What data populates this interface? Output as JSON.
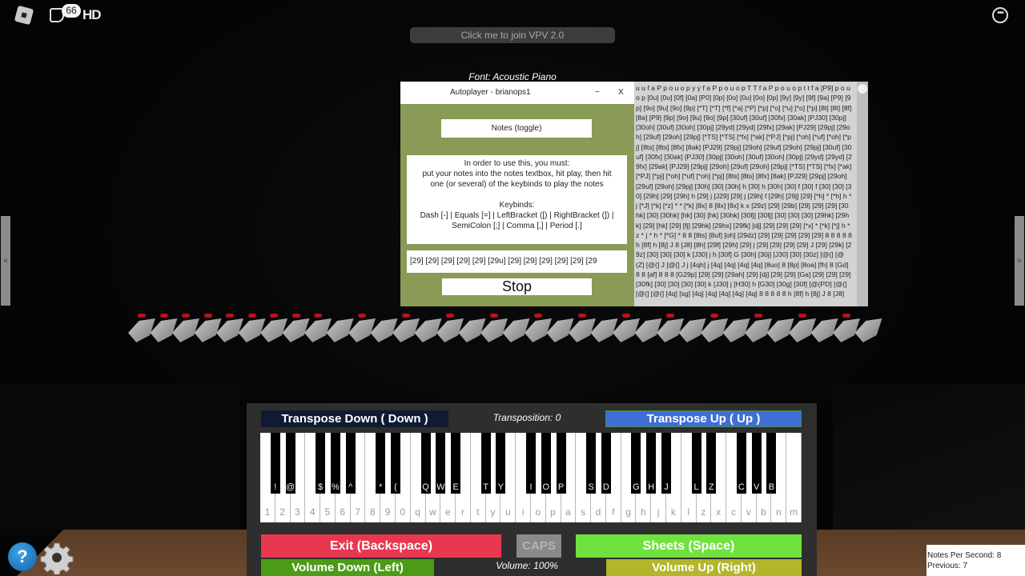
{
  "topbar": {
    "chat_badge_count": "66",
    "hd_label": "HD",
    "icons": [
      "roblox-logo-icon",
      "chat-icon",
      "menu-more-icon"
    ]
  },
  "join_button": {
    "label": "Click me to join VPV 2.0"
  },
  "font_label": "Font: Acoustic Piano",
  "side_arrows": {
    "left": "<",
    "right": ">"
  },
  "autoplayer": {
    "title": "Autoplayer - brianops1",
    "minimize_label": "~",
    "close_label": "X",
    "notes_toggle_label": "Notes (toggle)",
    "info": {
      "line1": "In order to use this, you must:",
      "line2": "put your notes into the notes textbox, hit play, then hit",
      "line3": "one (or several) of the keybinds to play the notes",
      "keybinds_title": "Keybinds:",
      "keybinds_line1": "Dash [-] | Equals [=] | LeftBracket ([) | RightBracket (]) |",
      "keybinds_line2": "SemiColon [;] | Comma [,] | Period [.]"
    },
    "notes_input_value": "[29] [29] [29] [29] [29] [29u] [29] [29] [29] [29] [29] [29",
    "stop_label": "Stop",
    "accent_color": "#8a9a57"
  },
  "notes_textbox": {
    "content": "u u f a P p o u o p y y f a P p o u o p T T f a P p o u o p t t f a [P9] p o u o p [0u] [0u] [0f] [0a] [P0] [0p] [0o] [0u] [0o] [0p] [9y] [9y] [9f] [9a] [P9] [9p] [9o] [9u] [9o] [9p] [*T] [*T] [*f] [*a] [*P] [*p] [*o] [*u] [*o] [*p] [8t] [8t] [8f] [8a] [P9] [9p] [9o] [9u] [9o] [9p] [30uf] [30uf] [30fx] [30ak] [PJ30] [30pj] [30oh] [30uf] [30oh] [30pj] [29yd] [29yd] [29fx] [29ak] [PJ29] [29pj] [29oh] [29uf] [29oh] [29pj] [*TS] [*TS] [*fx] [*ak] [*PJ] [*pj] [*oh] [*uf] [*oh] [*pj] [8ts] [8ts] [8fx] [8ak] [PJ29] [29pj] [29oh] [29uf] [29oh] [29pj] [30uf] [30uf] [30fx] [30ak] [PJ30] [30pj] [30oh] [30uf] [30oh] [30pj] [29yd] [29yd] [29fx] [29ak] [PJ29] [29pj] [29oh] [29uf] [29oh] [29pj] [*TS] [*TS] [*fx] [*ak] [*PJ] [*pj] [*oh] [*uf] [*oh] [*pj] [8ts] [8ts] [8fx] [8ak] [PJ29] [29pj] [29oh] [29uf] [29oh] [29pj] [30h] [30] [30h] h [30] h [30h] [30] f [30] f [30] [30] [30] [29h] [29] [29h] h [29] j [J29] [29] j [29h] f [29h] [29j] [29] [*h] * [*h] h * j [*J] [*k] [*z] * * [*k] [8x] 8 [8x] [8x] k x [29z] [29] [29b] [29] [29] [29] [30hk] [30] [30hk] [hk] [30] [hk] [30hk] [30fj] [30fj] [30] [30] [30] [29hk] [29hk] [29] [hk] [29] [fj] [29hk] [29hx] [29fk] [dj] [29] [29] [29] [*x] * [*k] [*j] h * z * j * h * [*G] * 8 8 [8ts] [8uf] [oh] [29dz] [29] [29] [29] [29] [29] 8 8 8 8 8 h [8f] h [8j] J 8 [J8] [8h] [29f] [29h] [29] j [29] [29] [29] [29] J [29] [29k] [29z] [30] [30] [30] k [J30] j h [30f] G [30h] [30j] [J30] [30] [30z] [@(] [@(Z] [@(] J [@(] J j [4qh] j [4q] [4q] [4q] [4q] [8uo] 8 [8p] [8oa] [fh] 8 [Gd] 8 8 [af] 8 8 8 [G29p] [29] [29] [29ah] [29] [dj] [29] [29] [Ga] [29] [29] [29] [30fk] [30] [30] [30] [30] k [J30] j [H30] h [G30] [30g] [30f] [@(PD] [@(] [@(] [@(] [4q] [sg] [4q] [4q] [4q] [4q] [4q] 8 8 8 8 8 h [8f] h [8j] J 8 [J8]"
  },
  "piano": {
    "transpose_down_label": "Transpose Down ( Down  )",
    "transposition_label": "Transposition: 0",
    "transpose_up_label": "Transpose Up (  Up  )",
    "white_keys": [
      "1",
      "2",
      "3",
      "4",
      "5",
      "6",
      "7",
      "8",
      "9",
      "0",
      "q",
      "w",
      "e",
      "r",
      "t",
      "y",
      "u",
      "i",
      "o",
      "p",
      "a",
      "s",
      "d",
      "f",
      "g",
      "h",
      "j",
      "k",
      "l",
      "z",
      "x",
      "c",
      "v",
      "b",
      "n",
      "m"
    ],
    "black_keys": [
      {
        "after": 0,
        "label": "!"
      },
      {
        "after": 1,
        "label": "@"
      },
      {
        "after": 3,
        "label": "$"
      },
      {
        "after": 4,
        "label": "%"
      },
      {
        "after": 5,
        "label": "^"
      },
      {
        "after": 7,
        "label": "*"
      },
      {
        "after": 8,
        "label": "("
      },
      {
        "after": 10,
        "label": "Q"
      },
      {
        "after": 11,
        "label": "W"
      },
      {
        "after": 12,
        "label": "E"
      },
      {
        "after": 14,
        "label": "T"
      },
      {
        "after": 15,
        "label": "Y"
      },
      {
        "after": 17,
        "label": "I"
      },
      {
        "after": 18,
        "label": "O"
      },
      {
        "after": 19,
        "label": "P"
      },
      {
        "after": 21,
        "label": "S"
      },
      {
        "after": 22,
        "label": "D"
      },
      {
        "after": 24,
        "label": "G"
      },
      {
        "after": 25,
        "label": "H"
      },
      {
        "after": 26,
        "label": "J"
      },
      {
        "after": 28,
        "label": "L"
      },
      {
        "after": 29,
        "label": "Z"
      },
      {
        "after": 31,
        "label": "C"
      },
      {
        "after": 32,
        "label": "V"
      },
      {
        "after": 33,
        "label": "B"
      }
    ]
  },
  "controls": {
    "exit_label": "Exit (Backspace)",
    "caps_label": "CAPS",
    "sheets_label": "Sheets (Space)",
    "volume_down_label": "Volume Down (Left)",
    "volume_label": "Volume: 100%",
    "volume_up_label": "Volume Up (Right)",
    "colors": {
      "exit": "#e8384f",
      "caps": "#8a8a8a",
      "sheets": "#6fe23e",
      "volume_down": "#4c9b18",
      "volume_up": "#b3b52b",
      "transpose_down": "#101a33",
      "transpose_up": "#3f6fd6"
    }
  },
  "bottom_left": {
    "help_label": "?",
    "icons": [
      "help-icon",
      "settings-gear-icon"
    ]
  },
  "stats": {
    "notes_per_second": "Notes Per Second: 8",
    "previous": "Previous: 7"
  }
}
